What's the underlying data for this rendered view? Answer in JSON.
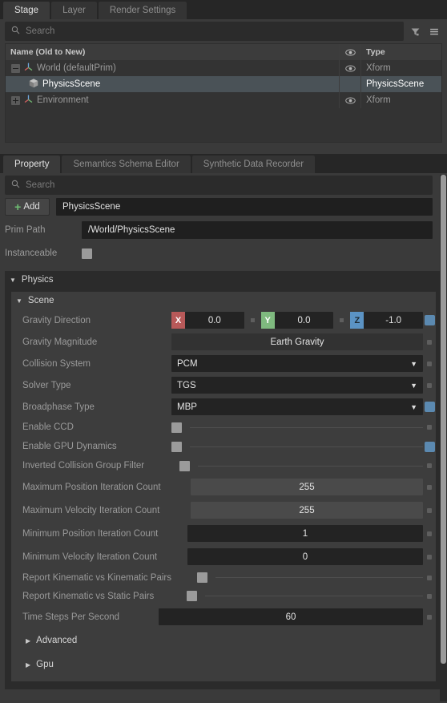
{
  "stage": {
    "tabs": [
      {
        "label": "Stage",
        "active": true
      },
      {
        "label": "Layer",
        "active": false
      },
      {
        "label": "Render Settings",
        "active": false
      }
    ],
    "search": {
      "placeholder": "Search"
    },
    "toolbar": {
      "filter_icon": "filter-icon",
      "menu_icon": "hamburger-menu-icon"
    },
    "tree": {
      "columns": {
        "name": "Name (Old to New)",
        "visibility": "eye-icon",
        "type": "Type"
      },
      "rows": [
        {
          "label": "World (defaultPrim)",
          "type": "Xform",
          "icon": "xform-axis-icon",
          "expander": "minus",
          "depth": 0,
          "visible": true,
          "selected": false
        },
        {
          "label": "PhysicsScene",
          "type": "PhysicsScene",
          "icon": "cube-icon",
          "expander": "none",
          "depth": 1,
          "visible": false,
          "selected": true
        },
        {
          "label": "Environment",
          "type": "Xform",
          "icon": "xform-axis-icon",
          "expander": "plus",
          "depth": 0,
          "visible": true,
          "selected": false
        }
      ]
    }
  },
  "property": {
    "tabs": [
      {
        "label": "Property",
        "active": true
      },
      {
        "label": "Semantics Schema Editor",
        "active": false
      },
      {
        "label": "Synthetic Data Recorder",
        "active": false
      }
    ],
    "search": {
      "placeholder": "Search"
    },
    "add_button": "Add",
    "prim_name": "PhysicsScene",
    "prim_path_label": "Prim Path",
    "prim_path_value": "/World/PhysicsScene",
    "instanceable_label": "Instanceable",
    "instanceable_checked": false,
    "sections": {
      "physics": {
        "label": "Physics",
        "expanded": true
      },
      "scene": {
        "label": "Scene",
        "expanded": true
      },
      "advanced": {
        "label": "Advanced",
        "expanded": false
      },
      "gpu": {
        "label": "Gpu",
        "expanded": false
      }
    },
    "fields": {
      "gravity_direction": {
        "label": "Gravity Direction",
        "x": "0.0",
        "y": "0.0",
        "z": "-1.0",
        "x_tag": "X",
        "y_tag": "Y",
        "z_tag": "Z",
        "modified": true
      },
      "gravity_magnitude": {
        "label": "Gravity Magnitude",
        "value": "Earth Gravity",
        "modified": false
      },
      "collision_system": {
        "label": "Collision System",
        "value": "PCM",
        "modified": false
      },
      "solver_type": {
        "label": "Solver Type",
        "value": "TGS",
        "modified": false
      },
      "broadphase_type": {
        "label": "Broadphase Type",
        "value": "MBP",
        "modified": true
      },
      "enable_ccd": {
        "label": "Enable CCD",
        "checked": false,
        "modified": false
      },
      "enable_gpu_dynamics": {
        "label": "Enable GPU Dynamics",
        "checked": false,
        "modified": true
      },
      "inverted_collision_group_filter": {
        "label": "Inverted Collision Group Filter",
        "checked": false,
        "modified": false
      },
      "max_position_iteration": {
        "label": "Maximum Position Iteration Count",
        "value": "255",
        "modified": false
      },
      "max_velocity_iteration": {
        "label": "Maximum Velocity Iteration Count",
        "value": "255",
        "modified": false
      },
      "min_position_iteration": {
        "label": "Minimum Position Iteration Count",
        "value": "1",
        "modified": false
      },
      "min_velocity_iteration": {
        "label": "Minimum Velocity Iteration Count",
        "value": "0",
        "modified": false
      },
      "report_kinematic_vs_kinematic": {
        "label": "Report Kinematic vs Kinematic Pairs",
        "checked": false,
        "modified": false
      },
      "report_kinematic_vs_static": {
        "label": "Report Kinematic vs Static Pairs",
        "checked": false,
        "modified": false
      },
      "time_steps_per_second": {
        "label": "Time Steps Per Second",
        "value": "60",
        "modified": false
      }
    }
  },
  "colors": {
    "axis_x": "#b85959",
    "axis_y": "#7fba7f",
    "axis_z": "#5b93c4",
    "modified_marker": "#5b89b0",
    "add_plus": "#6fbf73",
    "selection": "#4a5257"
  }
}
